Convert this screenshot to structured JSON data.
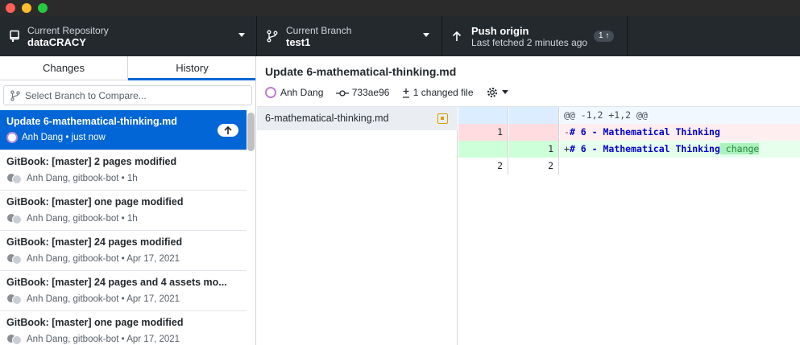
{
  "toolbar": {
    "repo": {
      "label": "Current Repository",
      "value": "dataCRACY"
    },
    "branch": {
      "label": "Current Branch",
      "value": "test1"
    },
    "push": {
      "label": "Push origin",
      "subtext": "Last fetched 2 minutes ago",
      "badge": "1 ↑"
    }
  },
  "sidebar": {
    "tabs": {
      "changes": "Changes",
      "history": "History"
    },
    "compare_placeholder": "Select Branch to Compare...",
    "commits": [
      {
        "title": "Update 6-mathematical-thinking.md",
        "meta": "Anh Dang • just now"
      },
      {
        "title": "GitBook: [master] 2 pages modified",
        "meta": "Anh Dang, gitbook-bot • 1h"
      },
      {
        "title": "GitBook: [master] one page modified",
        "meta": "Anh Dang, gitbook-bot • 1h"
      },
      {
        "title": "GitBook: [master] 24 pages modified",
        "meta": "Anh Dang, gitbook-bot • Apr 17, 2021"
      },
      {
        "title": "GitBook: [master] 24 pages and 4 assets mo...",
        "meta": "Anh Dang, gitbook-bot • Apr 17, 2021"
      },
      {
        "title": "GitBook: [master] one page modified",
        "meta": "Anh Dang, gitbook-bot • Apr 17, 2021"
      }
    ]
  },
  "commit_detail": {
    "title": "Update 6-mathematical-thinking.md",
    "author": "Anh Dang",
    "sha": "733ae96",
    "changed_files": "1 changed file"
  },
  "files": [
    {
      "name": "6-mathematical-thinking.md"
    }
  ],
  "diff": {
    "hunk_header": "@@ -1,2 +1,2 @@",
    "lines": [
      {
        "old": "1",
        "new": "",
        "sign": "-",
        "text": "# 6 - Mathematical Thinking",
        "added_word": ""
      },
      {
        "old": "",
        "new": "1",
        "sign": "+",
        "text": "# 6 - Mathematical Thinking",
        "added_word": " change"
      },
      {
        "old": "2",
        "new": "2",
        "sign": "",
        "text": "",
        "added_word": ""
      }
    ]
  },
  "colors": {
    "accent": "#0366d6",
    "toolbar_bg": "#24292e",
    "modified": "#d5a000"
  }
}
